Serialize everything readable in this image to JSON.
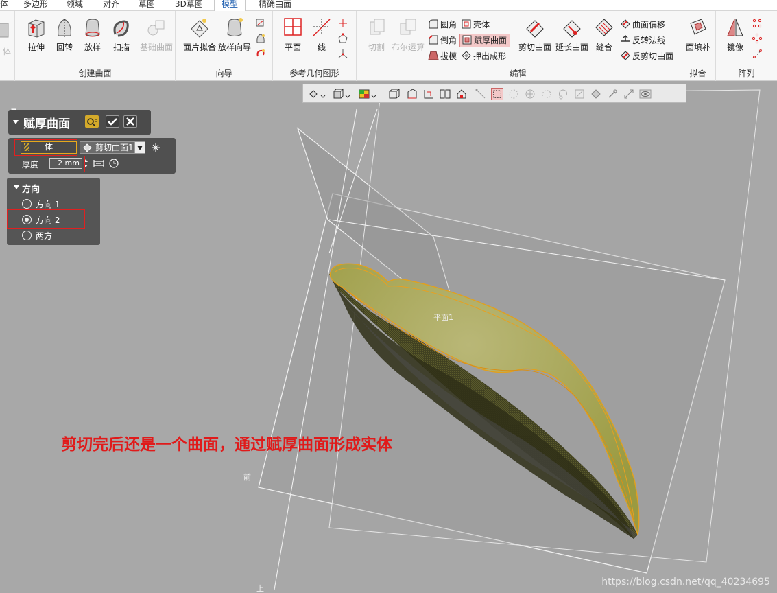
{
  "tabs": [
    "多边形",
    "领域",
    "对齐",
    "草图",
    "3D草图",
    "模型",
    "精确曲面"
  ],
  "tab_partial": "体",
  "ribbon": {
    "create_surface": {
      "label": "创建曲面",
      "buttons": [
        "拉伸",
        "回转",
        "放样",
        "扫描",
        "基础曲面"
      ]
    },
    "wizard": {
      "label": "向导",
      "buttons": [
        "面片拟合",
        "放样向导"
      ]
    },
    "ref_geometry": {
      "label": "参考几何图形",
      "buttons": [
        "平面",
        "线"
      ]
    },
    "edit": {
      "label": "编辑",
      "big_buttons": [
        "切割",
        "布尔运算",
        "剪切曲面",
        "延长曲面",
        "缝合"
      ],
      "small_col1": [
        "圆角",
        "倒角",
        "拔模"
      ],
      "small_col2": [
        "壳体",
        "赋厚曲面",
        "押出成形"
      ],
      "small_col3": [
        "曲面偏移",
        "反转法线",
        "反剪切曲面"
      ]
    },
    "fit": {
      "label": "拟合",
      "buttons": [
        "面填补"
      ]
    },
    "array": {
      "label": "阵列",
      "buttons": [
        "镜像"
      ]
    }
  },
  "panel": {
    "title": "赋厚曲面",
    "body_button": "体",
    "body_value": "剪切曲面1",
    "thickness_label": "厚度",
    "thickness_value": "2 mm"
  },
  "direction": {
    "title": "方向",
    "options": [
      "方向 1",
      "方向 2",
      "两方"
    ],
    "selected": "方向 2"
  },
  "viewport": {
    "plane_label": "平面1",
    "front_label": "前",
    "top_label": "上"
  },
  "annotation": "剪切完后还是一个曲面，通过赋厚曲面形成实体",
  "watermark": "https://blog.csdn.net/qq_40234695",
  "colors": {
    "accent_tab": "#1f5fb0",
    "highlight": "#f3c8c8",
    "annotation": "#e01a1a",
    "surface": "#a8a84a"
  }
}
